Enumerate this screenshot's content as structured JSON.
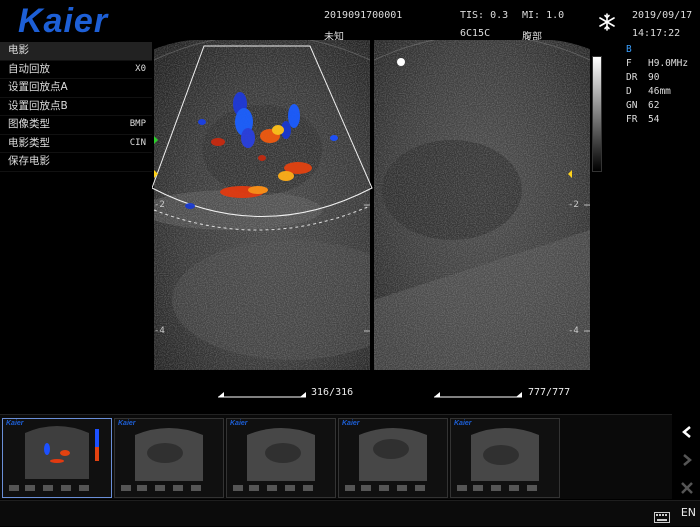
{
  "brand": {
    "logo_text": "Kaier"
  },
  "header": {
    "patient_id": "2019091700001",
    "patient_name": "未知",
    "tis": "TIS: 0.3",
    "mi": "MI: 1.0",
    "probe": "6C15C",
    "exam": "腹部",
    "date": "2019/09/17",
    "time": "14:17:22",
    "freeze_icon": "snowflake-icon"
  },
  "menu": {
    "title": "电影",
    "items": [
      {
        "label": "自动回放",
        "value": "X0"
      },
      {
        "label": "设置回放点A",
        "value": ""
      },
      {
        "label": "设置回放点B",
        "value": ""
      },
      {
        "label": "图像类型",
        "value": "BMP"
      },
      {
        "label": "电影类型",
        "value": "CIN"
      },
      {
        "label": "保存电影",
        "value": ""
      }
    ]
  },
  "params": {
    "mode": "B",
    "rows": [
      {
        "k": "F",
        "v": "H9.0MHz"
      },
      {
        "k": "DR",
        "v": "90"
      },
      {
        "k": "D",
        "v": "46mm"
      },
      {
        "k": "GN",
        "v": "62"
      },
      {
        "k": "FR",
        "v": "54"
      }
    ]
  },
  "scale": {
    "tick2": "-2",
    "tick4": "-4"
  },
  "cine": {
    "left_counter": "316/316",
    "right_counter": "777/777"
  },
  "nav": {
    "prev_icon": "chevron-left-icon",
    "next_icon": "chevron-right-icon",
    "close_icon": "close-icon"
  },
  "status": {
    "lang": "EN"
  }
}
